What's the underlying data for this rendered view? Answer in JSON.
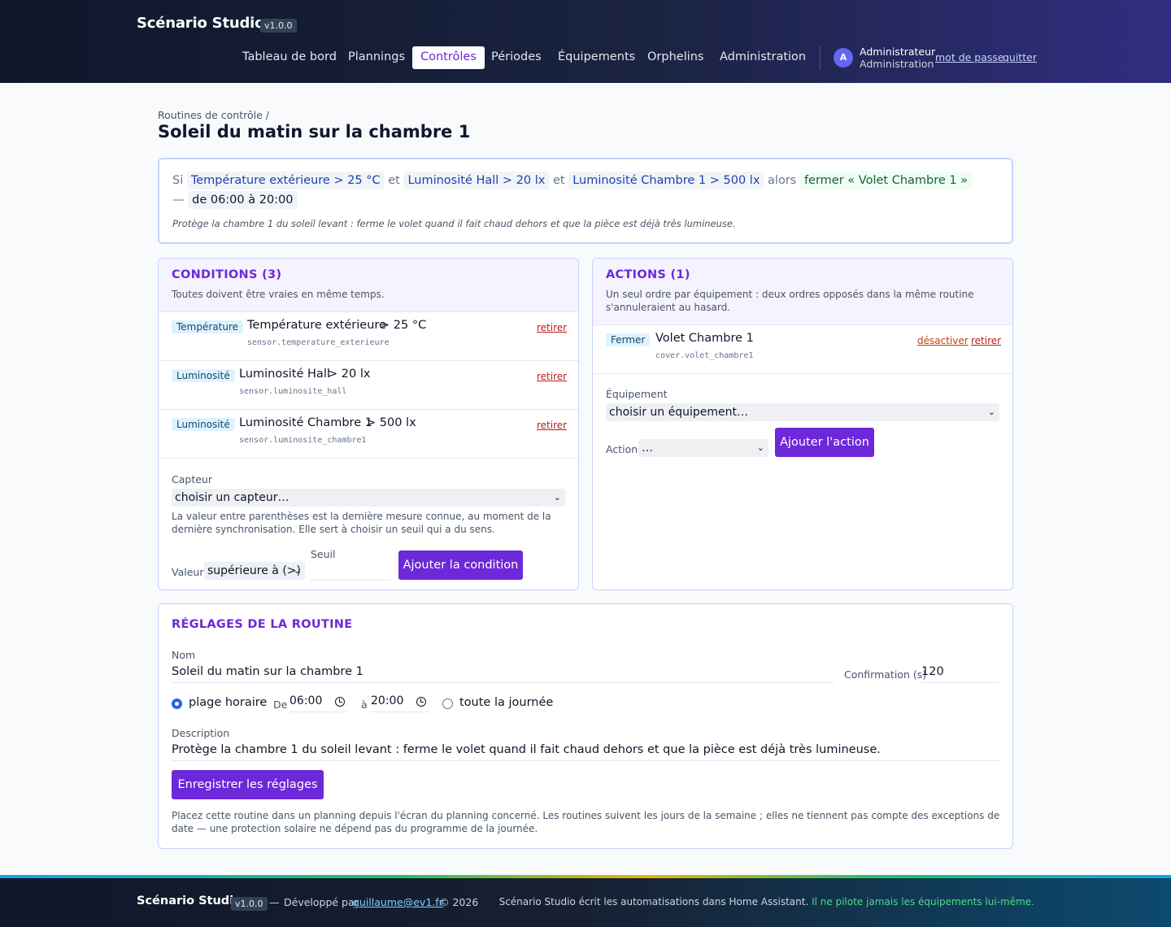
{
  "app": {
    "name": "Scénario Studio",
    "version": "v1.0.0"
  },
  "nav": {
    "items": [
      {
        "label": "Tableau de bord"
      },
      {
        "label": "Plannings"
      },
      {
        "label": "Contrôles",
        "active": true
      },
      {
        "label": "Périodes"
      },
      {
        "label": "Équipements"
      },
      {
        "label": "Orphelins"
      },
      {
        "label": "Administration"
      }
    ]
  },
  "user": {
    "initial": "A",
    "name": "Administrateur",
    "role": "Administration",
    "password_link": "mot de passe",
    "logout_link": "quitter"
  },
  "page": {
    "breadcrumb": "Routines de contrôle /",
    "title": "Soleil du matin sur la chambre 1"
  },
  "summary": {
    "si": "Si",
    "cond1": "Température extérieure > 25 °C",
    "et1": "et",
    "cond2": "Luminosité Hall > 20 lx",
    "et2": "et",
    "cond3": "Luminosité Chambre 1 > 500 lx",
    "alors": "alors",
    "action": "fermer « Volet Chambre 1 »",
    "dash": "—",
    "time": "de 06:00 à 20:00",
    "description": "Protège la chambre 1 du soleil levant : ferme le volet quand il fait chaud dehors et que la pièce est déjà très lumineuse."
  },
  "conditions": {
    "title": "CONDITIONS (3)",
    "subtitle": "Toutes doivent être vraies en même temps.",
    "items": [
      {
        "tag": "Température",
        "name": "Température extérieure",
        "threshold": "> 25 °C",
        "entity": "sensor.temperature_exterieure",
        "remove": "retirer"
      },
      {
        "tag": "Luminosité",
        "name": "Luminosité Hall",
        "threshold": "> 20 lx",
        "entity": "sensor.luminosite_hall",
        "remove": "retirer"
      },
      {
        "tag": "Luminosité",
        "name": "Luminosité Chambre 1",
        "threshold": "> 500 lx",
        "entity": "sensor.luminosite_chambre1",
        "remove": "retirer"
      }
    ],
    "form": {
      "sensor_label": "Capteur",
      "sensor_value": "choisir un capteur…",
      "hint": "La valeur entre parenthèses est la dernière mesure connue, au moment de la dernière synchronisation. Elle sert à choisir un seuil qui a du sens.",
      "value_label": "Valeur",
      "operator_value": "supérieure à (>)",
      "threshold_label": "Seuil",
      "threshold_value": "",
      "submit": "Ajouter la condition"
    }
  },
  "actions": {
    "title": "ACTIONS (1)",
    "subtitle": "Un seul ordre par équipement : deux ordres opposés dans la même routine s'annuleraient au hasard.",
    "items": [
      {
        "tag": "Fermer",
        "name": "Volet Chambre 1",
        "entity": "cover.volet_chambre1",
        "disable": "désactiver",
        "remove": "retirer"
      }
    ],
    "form": {
      "equipment_label": "Équipement",
      "equipment_value": "choisir un équipement…",
      "action_label": "Action",
      "action_value": "…",
      "submit": "Ajouter l'action"
    }
  },
  "settings": {
    "title": "RÉGLAGES DE LA ROUTINE",
    "name_label": "Nom",
    "name_value": "Soleil du matin sur la chambre 1",
    "confirm_label": "Confirmation (s)",
    "confirm_value": "120",
    "radio_range": "plage horaire",
    "from_label": "De",
    "from_value": "06:00",
    "to_label": "à",
    "to_value": "20:00",
    "radio_all_day": "toute la journée",
    "description_label": "Description",
    "description_value": "Protège la chambre 1 du soleil levant : ferme le volet quand il fait chaud dehors et que la pièce est déjà très lumineuse.",
    "save": "Enregistrer les réglages",
    "note": "Placez cette routine dans un planning depuis l'écran du planning concerné. Les routines suivent les jours de la semaine ; elles ne tiennent pas compte des exceptions de date — une protection solaire ne dépend pas du programme de la journée."
  },
  "footer": {
    "brand": "Scénario Studio",
    "version": "v1.0.0",
    "sep": "—",
    "dev_by": "Développé par",
    "email": "guillaume@ev1.fr",
    "year": "© 2026",
    "note": "Scénario Studio écrit les automatisations dans Home Assistant.",
    "note_highlight": "Il ne pilote jamais les équipements lui-même."
  },
  "colors": {
    "accent": "#6d28d9",
    "header_bg": "#0f172a",
    "tag_bg": "#e0f2fe",
    "remove": "#b91c1c",
    "disable": "#c2410c"
  }
}
